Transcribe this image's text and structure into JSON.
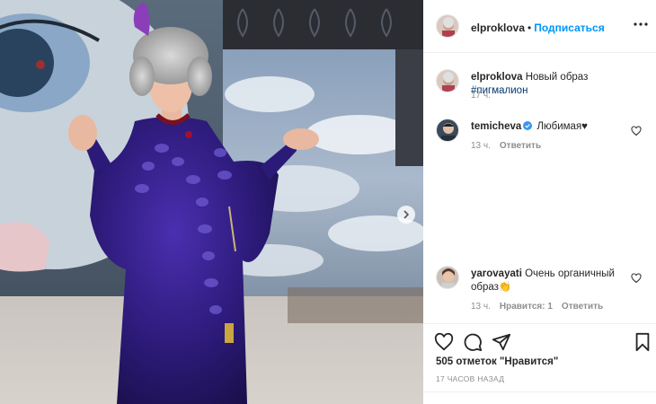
{
  "post": {
    "author": "elproklova",
    "follow_label": "Подписаться",
    "separator": "•",
    "caption_user": "elproklova",
    "caption_text": "Новый образ",
    "caption_hashtag": "#пигмалион",
    "caption_time": "17 ч."
  },
  "comments": [
    {
      "user": "temicheva",
      "verified": true,
      "text": "Любимая♥",
      "time": "13 ч.",
      "reply_label": "Ответить"
    },
    {
      "user": "yarovayati",
      "verified": false,
      "text": "Очень органичный образ👏",
      "time": "13 ч.",
      "likes_label": "Нравится: 1",
      "reply_label": "Ответить"
    }
  ],
  "footer": {
    "likes": "505 отметок \"Нравится\"",
    "time_ago": "17 ЧАСОВ НАЗАД"
  },
  "colors": {
    "link_blue": "#0095f6",
    "hashtag_blue": "#00376b",
    "secondary_text": "#8e8e8e",
    "dress_purple": "#3a1f8a"
  },
  "icons": [
    "more-options-icon",
    "heart-icon",
    "comment-icon",
    "share-icon",
    "bookmark-icon",
    "verified-badge-icon",
    "chevron-right-icon"
  ]
}
